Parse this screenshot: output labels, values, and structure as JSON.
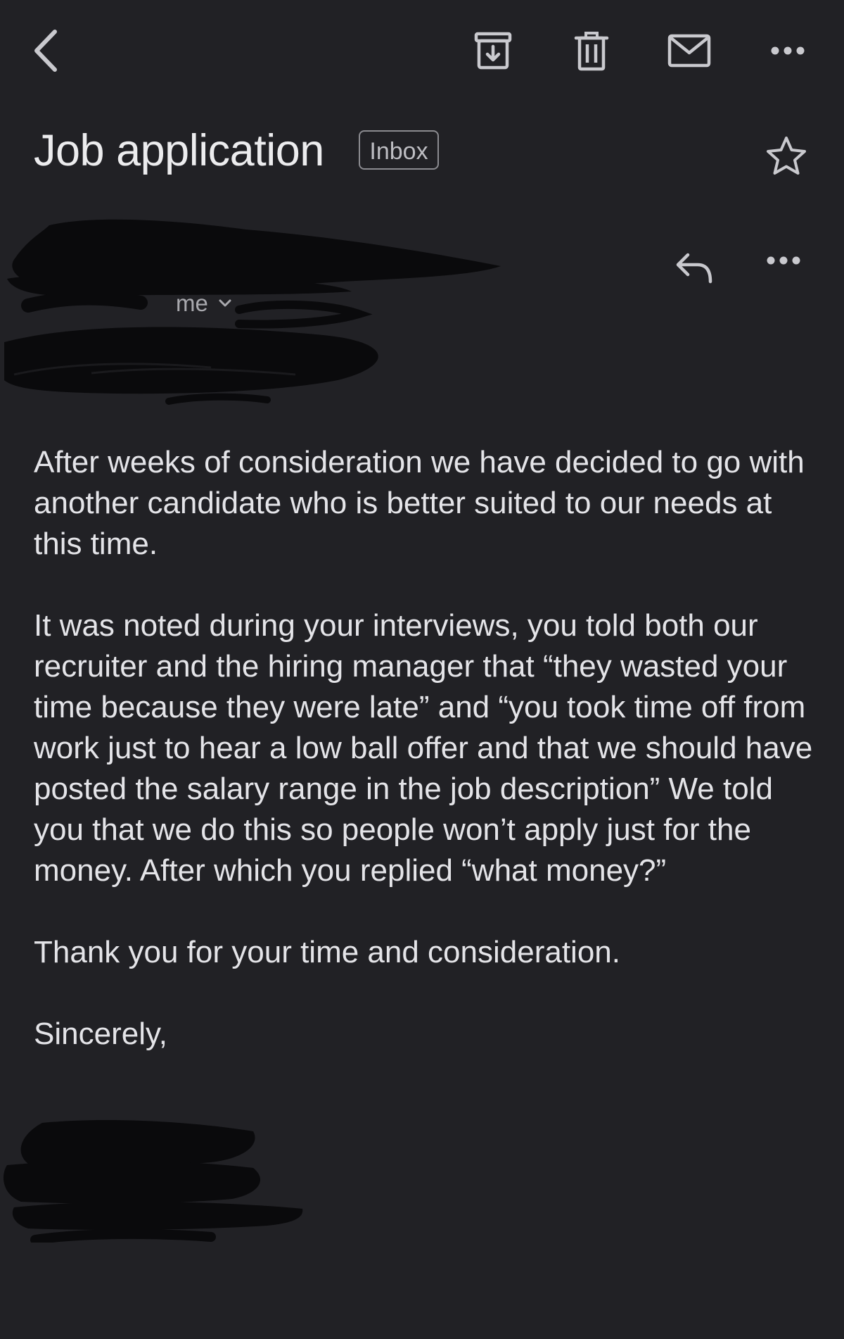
{
  "toolbar": {
    "back_icon": "chevron-left-icon",
    "archive_icon": "archive-icon",
    "delete_icon": "trash-icon",
    "mark_unread_icon": "mail-icon",
    "more_icon": "more-horizontal-icon"
  },
  "message": {
    "subject": "Job application",
    "label": "Inbox",
    "recipient": "me",
    "body": [
      "After weeks of consideration we have decided to go with another candidate who is better suited to our needs at this time.",
      "It was noted during your interviews, you told both our recruiter and the hiring manager that “they wasted your time because they were late” and “you took time off from work just to hear a low ball offer and that we should have posted the salary range in the job description” We told you that we do this so people won’t apply just for the money. After which you replied “what money?”",
      "Thank you for your time and consideration.",
      "Sincerely,"
    ]
  },
  "colors": {
    "background": "#212125",
    "text": "#e4e4e8",
    "icon": "#c9c9ce",
    "redaction": "#0a0a0c"
  }
}
